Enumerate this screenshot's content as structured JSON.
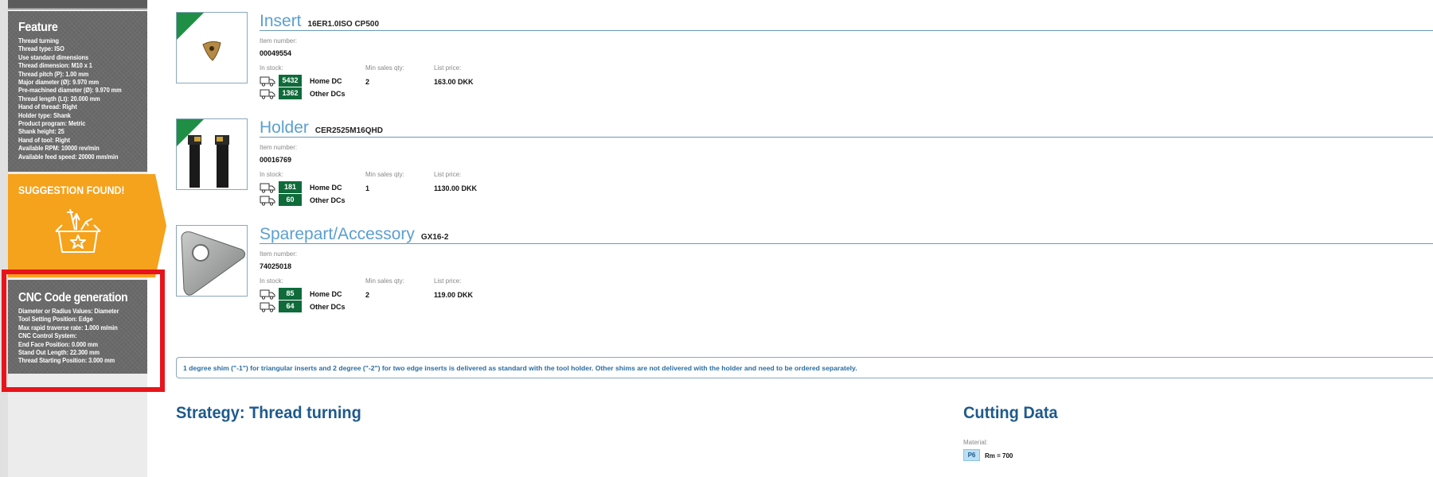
{
  "sidebar": {
    "feature": {
      "title": "Feature",
      "lines": [
        "Thread turning",
        "Thread type: ISO",
        "Use standard dimensions",
        "Thread dimension: M10 x 1",
        "Thread pitch (P): 1.00 mm",
        "Major diameter (Ø): 9.970 mm",
        "Pre-machined diameter (Ø): 9.970 mm",
        "Thread length (Lt): 20.000 mm",
        "Hand of thread: Right",
        "Holder type: Shank",
        "Product program: Metric",
        "Shank height: 25",
        "Hand of tool: Right",
        "Available RPM: 10000 rev/min",
        "Available feed speed: 20000 mm/min"
      ]
    },
    "suggestion": {
      "title": "SUGGESTION FOUND!",
      "icon": "toolbox-star-icon",
      "color": "#f5a21c"
    },
    "cnc": {
      "title": "CNC Code generation",
      "lines": [
        "Diameter or Radius Values: Diameter",
        "Tool Setting Position: Edge",
        "Max rapid traverse rate: 1.000 m/min",
        "CNC Control System:",
        "End Face Position: 0.000 mm",
        "Stand Out Length: 22.300 mm",
        "Thread Starting Position: 3.000 mm"
      ],
      "highlight_color": "#e8141b"
    }
  },
  "labels": {
    "item_number": "Item number:",
    "in_stock": "In stock:",
    "min_sales_qty": "Min sales qty:",
    "list_price": "List price:",
    "home_dc": "Home DC",
    "other_dcs": "Other DCs"
  },
  "products": [
    {
      "title": "Insert",
      "code": "16ER1.0ISO CP500",
      "item_number": "00049554",
      "stock_home": "5432",
      "stock_other": "1362",
      "min_qty": "2",
      "price": "163.00 DKK",
      "image": "insert-image"
    },
    {
      "title": "Holder",
      "code": "CER2525M16QHD",
      "item_number": "00016769",
      "stock_home": "181",
      "stock_other": "60",
      "min_qty": "1",
      "price": "1130.00 DKK",
      "image": "holder-image"
    },
    {
      "title": "Sparepart/Accessory",
      "code": "GX16-2",
      "item_number": "74025018",
      "stock_home": "85",
      "stock_other": "64",
      "min_qty": "2",
      "price": "119.00 DKK",
      "image": "shim-image"
    }
  ],
  "note": "1 degree shim (\"-1\") for triangular inserts and 2 degree (\"-2\") for two edge inserts is delivered as standard with the tool holder. Other shims are not delivered with the holder and need to be ordered separately.",
  "strategy": {
    "title": "Strategy: Thread turning"
  },
  "cutting_data": {
    "title": "Cutting Data",
    "material_label": "Material:",
    "material_code": "P6",
    "material_value": "Rm = 700"
  },
  "colors": {
    "accent_green": "#0f6b3a",
    "title_blue": "#5b9fd0",
    "heading_blue": "#1e5a8c"
  }
}
